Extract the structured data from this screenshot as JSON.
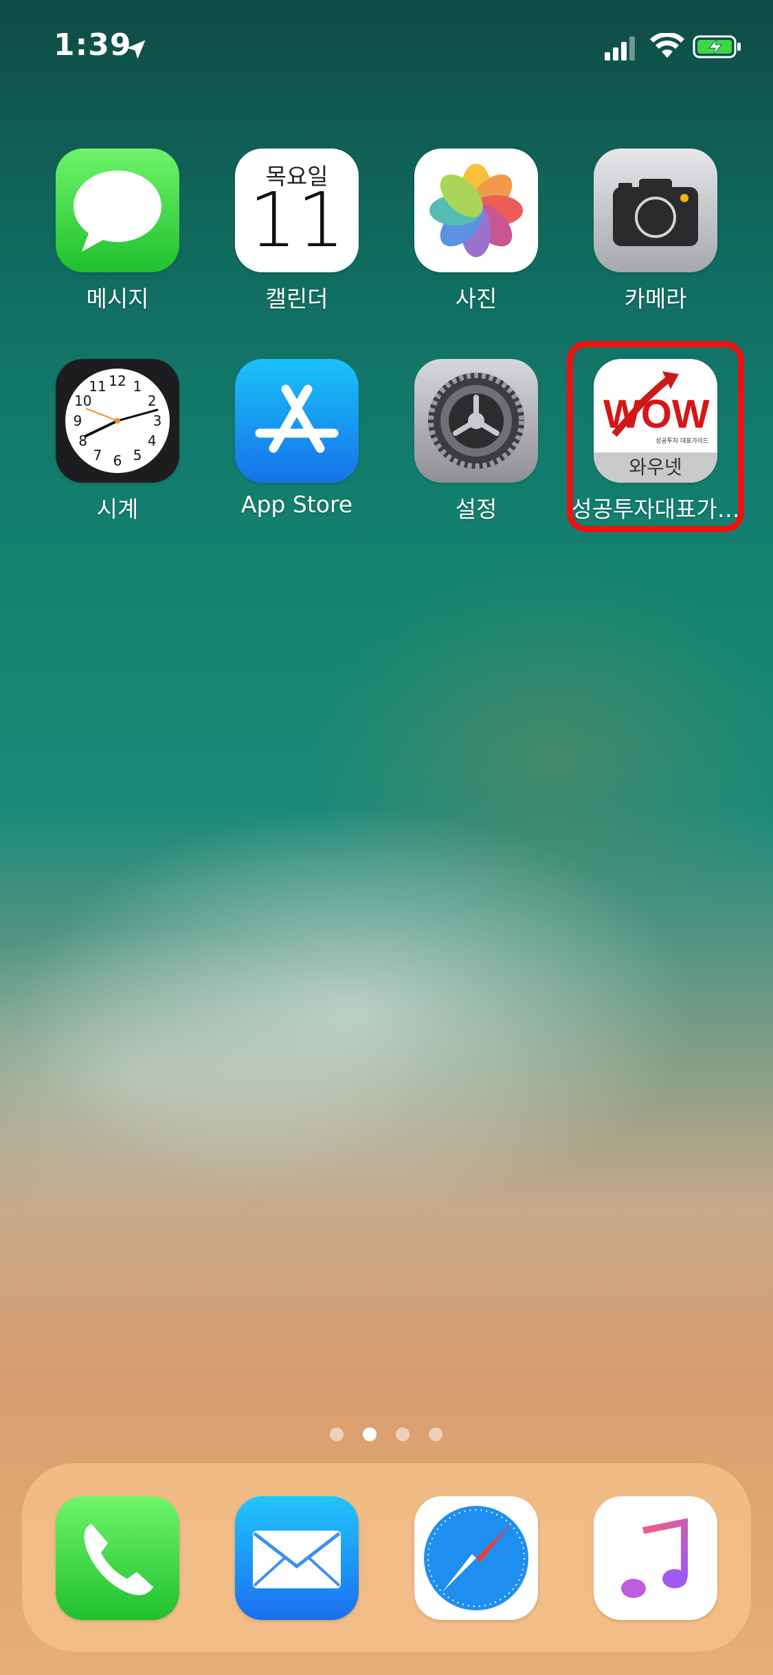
{
  "status_bar": {
    "time": "1:39",
    "location_icon": "location-arrow-icon",
    "signal_icon": "cellular-signal-icon",
    "wifi_icon": "wifi-icon",
    "battery_icon": "battery-charging-icon",
    "battery_color": "#3dd64a"
  },
  "home_apps": [
    {
      "label": "메시지",
      "icon": "messages-icon"
    },
    {
      "label": "캘린더",
      "icon": "calendar-icon",
      "day": "목요일",
      "date": "11"
    },
    {
      "label": "사진",
      "icon": "photos-icon"
    },
    {
      "label": "카메라",
      "icon": "camera-icon"
    },
    {
      "label": "시계",
      "icon": "clock-icon"
    },
    {
      "label": "App Store",
      "icon": "app-store-icon"
    },
    {
      "label": "설정",
      "icon": "settings-gear-icon"
    },
    {
      "label": "성공투자대표가…",
      "icon": "wownet-icon",
      "icon_brand": "WOW",
      "icon_tagline": "성공투자 대표가이드",
      "icon_caption": "와우넷",
      "highlighted": true,
      "highlight_color": "#ee1111"
    }
  ],
  "clock_numbers": [
    "12",
    "1",
    "2",
    "3",
    "4",
    "5",
    "6",
    "7",
    "8",
    "9",
    "10",
    "11"
  ],
  "page_indicator": {
    "total": 4,
    "current": 2
  },
  "dock": [
    {
      "icon": "phone-icon"
    },
    {
      "icon": "mail-icon"
    },
    {
      "icon": "safari-compass-icon"
    },
    {
      "icon": "music-note-icon"
    }
  ]
}
